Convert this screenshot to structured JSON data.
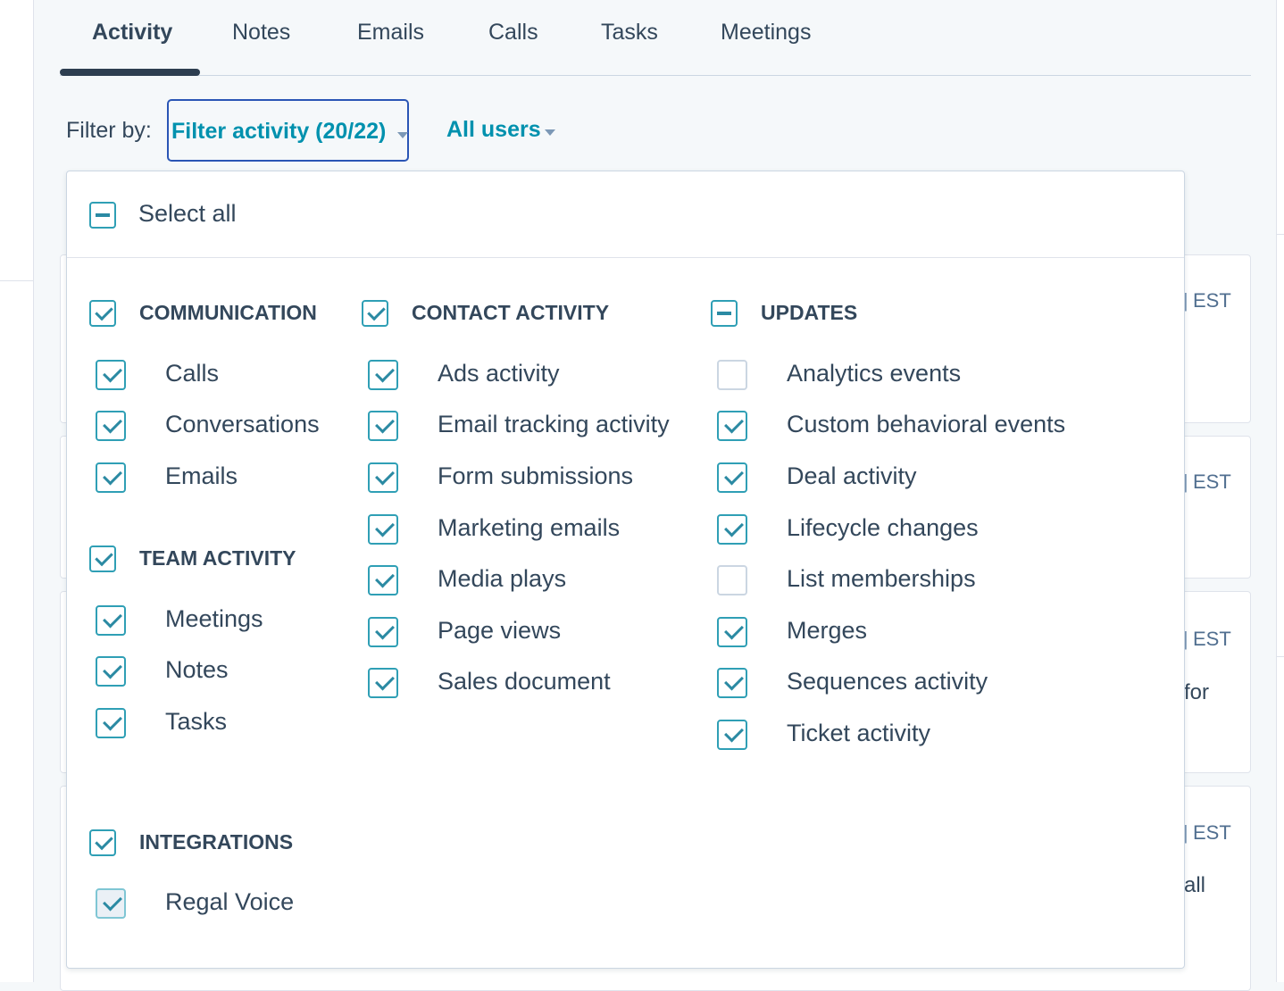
{
  "tabs": [
    "Activity",
    "Notes",
    "Emails",
    "Calls",
    "Tasks",
    "Meetings"
  ],
  "filter": {
    "label": "Filter by:",
    "activity_button": "Filter activity (20/22)",
    "users_button": "All users"
  },
  "background": {
    "est": "EST",
    "fragments": [
      "for",
      "all"
    ]
  },
  "dropdown": {
    "select_all": {
      "label": "Select all",
      "state": "indeterminate"
    },
    "groups": {
      "communication": {
        "label": "COMMUNICATION",
        "state": "checked",
        "items": [
          {
            "label": "Calls",
            "state": "checked"
          },
          {
            "label": "Conversations",
            "state": "checked"
          },
          {
            "label": "Emails",
            "state": "checked"
          }
        ]
      },
      "team_activity": {
        "label": "TEAM ACTIVITY",
        "state": "checked",
        "items": [
          {
            "label": "Meetings",
            "state": "checked"
          },
          {
            "label": "Notes",
            "state": "checked"
          },
          {
            "label": "Tasks",
            "state": "checked"
          }
        ]
      },
      "integrations": {
        "label": "INTEGRATIONS",
        "state": "checked",
        "items": [
          {
            "label": "Regal Voice",
            "state": "checked-disabled"
          }
        ]
      },
      "contact_activity": {
        "label": "CONTACT ACTIVITY",
        "state": "checked",
        "items": [
          {
            "label": "Ads activity",
            "state": "checked"
          },
          {
            "label": "Email tracking activity",
            "state": "checked"
          },
          {
            "label": "Form submissions",
            "state": "checked"
          },
          {
            "label": "Marketing emails",
            "state": "checked"
          },
          {
            "label": "Media plays",
            "state": "checked"
          },
          {
            "label": "Page views",
            "state": "checked"
          },
          {
            "label": "Sales document",
            "state": "checked"
          }
        ]
      },
      "updates": {
        "label": "UPDATES",
        "state": "indeterminate",
        "items": [
          {
            "label": "Analytics events",
            "state": "unchecked"
          },
          {
            "label": "Custom behavioral events",
            "state": "checked"
          },
          {
            "label": "Deal activity",
            "state": "checked"
          },
          {
            "label": "Lifecycle changes",
            "state": "checked"
          },
          {
            "label": "List memberships",
            "state": "unchecked"
          },
          {
            "label": "Merges",
            "state": "checked"
          },
          {
            "label": "Sequences activity",
            "state": "checked"
          },
          {
            "label": "Ticket activity",
            "state": "checked"
          }
        ]
      }
    }
  },
  "colors": {
    "accent": "#0091ae",
    "checkbox": "#2f9fb5",
    "text": "#33475b",
    "focus_border": "#2a55b5"
  }
}
